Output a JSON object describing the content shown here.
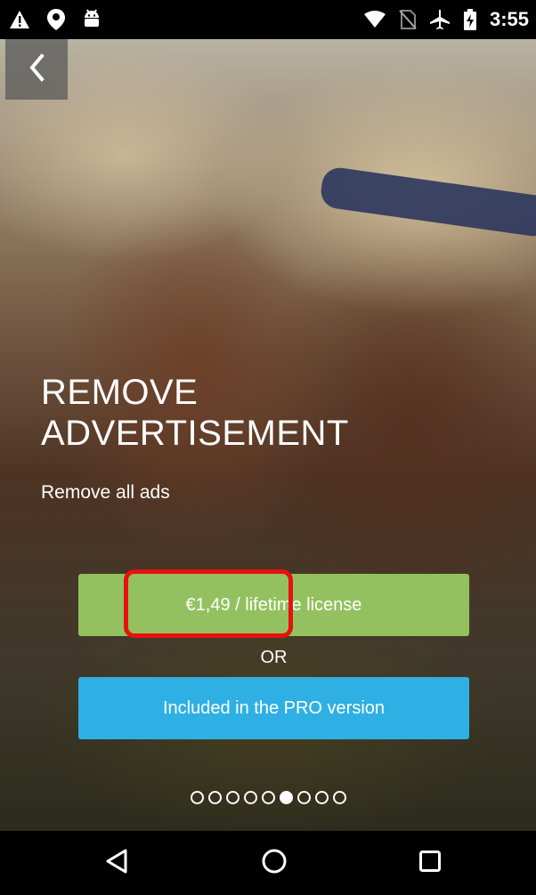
{
  "status_bar": {
    "time": "3:55",
    "left_icons": [
      "warning-icon",
      "location-icon",
      "android-icon"
    ],
    "right_icons": [
      "wifi-icon",
      "no-sim-icon",
      "airplane-icon",
      "battery-charging-icon"
    ]
  },
  "header": {
    "back_icon": "chevron-left-icon"
  },
  "promo": {
    "title": "REMOVE ADVERTISEMENT",
    "subtitle": "Remove all ads"
  },
  "buttons": {
    "buy_label": "€1,49 / lifetime license",
    "or_label": "OR",
    "pro_label": "Included in the PRO version"
  },
  "pager": {
    "total": 9,
    "active_index": 5
  },
  "nav_bar": {
    "icons": [
      "back-triangle-icon",
      "home-circle-icon",
      "recents-square-icon"
    ]
  },
  "colors": {
    "buy_button": "#94c15f",
    "pro_button": "#2fb0e4",
    "highlight": "#e8110f"
  }
}
